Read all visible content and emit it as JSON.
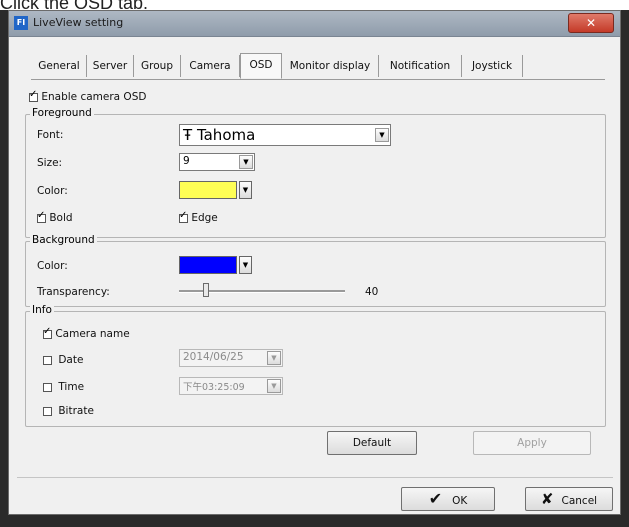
{
  "caption": "Click the OSD tab.",
  "window": {
    "title": "LiveView setting",
    "close": "✕"
  },
  "tabs": [
    "General",
    "Server",
    "Group",
    "Camera",
    "OSD",
    "Monitor display",
    "Notification",
    "Joystick"
  ],
  "osd": {
    "enable_label": "Enable camera OSD",
    "foreground": {
      "title": "Foreground",
      "font_label": "Font:",
      "font_value": "Tahoma",
      "size_label": "Size:",
      "size_value": "9",
      "color_label": "Color:",
      "color": "#ffff55",
      "bold_label": "Bold",
      "edge_label": "Edge"
    },
    "background": {
      "title": "Background",
      "color_label": "Color:",
      "color": "#0000ff",
      "transparency_label": "Transparency:",
      "transparency_value": "40"
    },
    "info": {
      "title": "Info",
      "camera_name_label": "Camera name",
      "date_label": "Date",
      "date_value": "2014/06/25",
      "time_label": "Time",
      "time_value": "下午03:25:09",
      "bitrate_label": "Bitrate"
    }
  },
  "buttons": {
    "default": "Default",
    "apply": "Apply",
    "ok": "OK",
    "cancel": "Cancel"
  }
}
